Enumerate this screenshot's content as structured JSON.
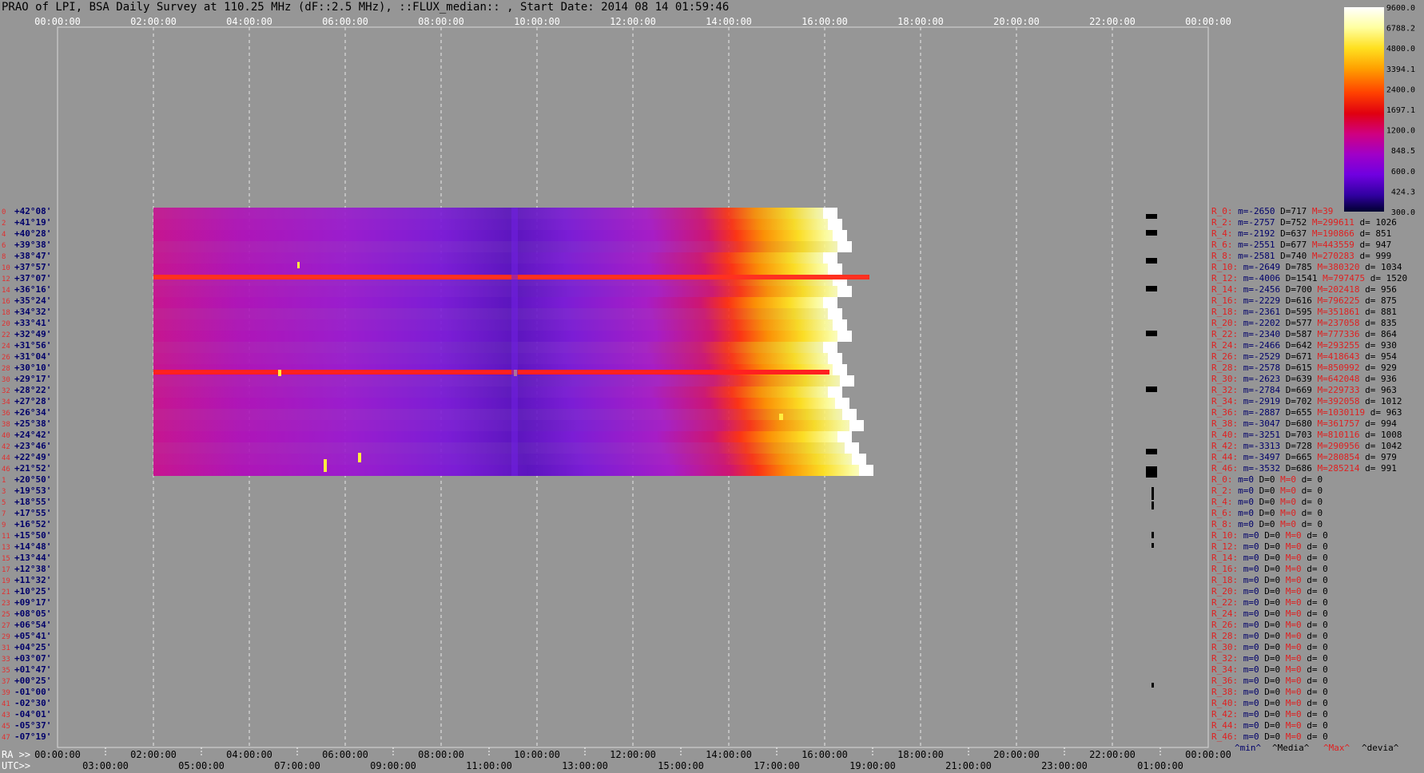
{
  "title": "PRAO of LPI, BSA Daily Survey at 110.25 MHz (dF::2.5 MHz), ::FLUX_median:: , Start Date: 2014 08 14 01:59:46",
  "colorbar": {
    "ticks": [
      "9600.0",
      "6788.2",
      "4800.0",
      "3394.1",
      "2400.0",
      "1697.1",
      "1200.0",
      "848.5",
      "600.0",
      "424.3",
      "300.0"
    ],
    "colors": [
      "#ffffff",
      "#ffffa0",
      "#ffe020",
      "#ffa000",
      "#ff4000",
      "#e00010",
      "#d00080",
      "#a000c8",
      "#7000e0",
      "#3000a0",
      "#000030"
    ]
  },
  "chart_data": {
    "type": "heatmap",
    "top_axis_ticks": [
      "00:00:00",
      "02:00:00",
      "04:00:00",
      "06:00:00",
      "08:00:00",
      "10:00:00",
      "12:00:00",
      "14:00:00",
      "16:00:00",
      "18:00:00",
      "20:00:00",
      "22:00:00",
      "00:00:00"
    ],
    "bottom_ra_label": "RA >>",
    "bottom_ra_ticks": [
      "00:00:00",
      "02:00:00",
      "04:00:00",
      "06:00:00",
      "08:00:00",
      "10:00:00",
      "12:00:00",
      "14:00:00",
      "16:00:00",
      "18:00:00",
      "20:00:00",
      "22:00:00",
      "00:00:00"
    ],
    "bottom_utc_label": "UTC>>",
    "bottom_utc_ticks": [
      "03:00:00",
      "05:00:00",
      "07:00:00",
      "09:00:00",
      "11:00:00",
      "13:00:00",
      "15:00:00",
      "17:00:00",
      "19:00:00",
      "21:00:00",
      "23:00:00",
      "01:00:00"
    ],
    "declination_labels": [
      "+42°08'",
      "+41°19'",
      "+40°28'",
      "+39°38'",
      "+38°47'",
      "+37°57'",
      "+37°07'",
      "+36°16'",
      "+35°24'",
      "+34°32'",
      "+33°41'",
      "+32°49'",
      "+31°56'",
      "+31°04'",
      "+30°10'",
      "+29°17'",
      "+28°22'",
      "+27°28'",
      "+26°34'",
      "+25°38'",
      "+24°42'",
      "+23°46'",
      "+22°49'",
      "+21°52'",
      "+20°50'",
      "+19°53'",
      "+18°55'",
      "+17°55'",
      "+16°52'",
      "+15°50'",
      "+14°48'",
      "+13°44'",
      "+12°38'",
      "+11°32'",
      "+10°25'",
      "+09°17'",
      "+08°05'",
      "+06°54'",
      "+05°41'",
      "+04°25'",
      "+03°07'",
      "+01°47'",
      "+00°25'",
      "-01°00'",
      "-02°30'",
      "-04°01'",
      "-05°37'",
      "-07°19'"
    ],
    "beam_indices": [
      "0",
      "2",
      "4",
      "6",
      "8",
      "10",
      "12",
      "14",
      "16",
      "18",
      "20",
      "22",
      "24",
      "26",
      "28",
      "30",
      "32",
      "34",
      "36",
      "38",
      "40",
      "42",
      "44",
      "46",
      "1",
      "3",
      "5",
      "7",
      "9",
      "11",
      "13",
      "15",
      "17",
      "19",
      "21",
      "23",
      "25",
      "27",
      "29",
      "31",
      "33",
      "35",
      "37",
      "39",
      "41",
      "43",
      "45",
      "47"
    ],
    "stats": [
      {
        "r": "R_0:",
        "m": "-2650",
        "D": "717",
        "M": "39",
        "d": ""
      },
      {
        "r": "R_2:",
        "m": "-2757",
        "D": "752",
        "M": "299611",
        "d": "1026"
      },
      {
        "r": "R_4:",
        "m": "-2192",
        "D": "637",
        "M": "190866",
        "d": "851"
      },
      {
        "r": "R_6:",
        "m": "-2551",
        "D": "677",
        "M": "443559",
        "d": "947"
      },
      {
        "r": "R_8:",
        "m": "-2581",
        "D": "740",
        "M": "270283",
        "d": "999"
      },
      {
        "r": "R_10:",
        "m": "-2649",
        "D": "785",
        "M": "380320",
        "d": "1034"
      },
      {
        "r": "R_12:",
        "m": "-4006",
        "D": "1541",
        "M": "797475",
        "d": "1520"
      },
      {
        "r": "R_14:",
        "m": "-2456",
        "D": "700",
        "M": "202418",
        "d": "956"
      },
      {
        "r": "R_16:",
        "m": "-2229",
        "D": "616",
        "M": "796225",
        "d": "875"
      },
      {
        "r": "R_18:",
        "m": "-2361",
        "D": "595",
        "M": "351861",
        "d": "881"
      },
      {
        "r": "R_20:",
        "m": "-2202",
        "D": "577",
        "M": "237058",
        "d": "835"
      },
      {
        "r": "R_22:",
        "m": "-2340",
        "D": "587",
        "M": "777336",
        "d": "864"
      },
      {
        "r": "R_24:",
        "m": "-2466",
        "D": "642",
        "M": "293255",
        "d": "930"
      },
      {
        "r": "R_26:",
        "m": "-2529",
        "D": "671",
        "M": "418643",
        "d": "954"
      },
      {
        "r": "R_28:",
        "m": "-2578",
        "D": "615",
        "M": "850992",
        "d": "929"
      },
      {
        "r": "R_30:",
        "m": "-2623",
        "D": "639",
        "M": "642048",
        "d": "936"
      },
      {
        "r": "R_32:",
        "m": "-2784",
        "D": "669",
        "M": "229733",
        "d": "963"
      },
      {
        "r": "R_34:",
        "m": "-2919",
        "D": "702",
        "M": "392058",
        "d": "1012"
      },
      {
        "r": "R_36:",
        "m": "-2887",
        "D": "655",
        "M": "1030119",
        "d": "963"
      },
      {
        "r": "R_38:",
        "m": "-3047",
        "D": "680",
        "M": "361757",
        "d": "994"
      },
      {
        "r": "R_40:",
        "m": "-3251",
        "D": "703",
        "M": "810116",
        "d": "1008"
      },
      {
        "r": "R_42:",
        "m": "-3313",
        "D": "728",
        "M": "290956",
        "d": "1042"
      },
      {
        "r": "R_44:",
        "m": "-3497",
        "D": "665",
        "M": "280854",
        "d": "979"
      },
      {
        "r": "R_46:",
        "m": "-3532",
        "D": "686",
        "M": "285214",
        "d": "991"
      },
      {
        "r": "R_0:",
        "m": "0",
        "D": "0",
        "M": "0",
        "d": "0"
      },
      {
        "r": "R_2:",
        "m": "0",
        "D": "0",
        "M": "0",
        "d": "0"
      },
      {
        "r": "R_4:",
        "m": "0",
        "D": "0",
        "M": "0",
        "d": "0"
      },
      {
        "r": "R_6:",
        "m": "0",
        "D": "0",
        "M": "0",
        "d": "0"
      },
      {
        "r": "R_8:",
        "m": "0",
        "D": "0",
        "M": "0",
        "d": "0"
      },
      {
        "r": "R_10:",
        "m": "0",
        "D": "0",
        "M": "0",
        "d": "0"
      },
      {
        "r": "R_12:",
        "m": "0",
        "D": "0",
        "M": "0",
        "d": "0"
      },
      {
        "r": "R_14:",
        "m": "0",
        "D": "0",
        "M": "0",
        "d": "0"
      },
      {
        "r": "R_16:",
        "m": "0",
        "D": "0",
        "M": "0",
        "d": "0"
      },
      {
        "r": "R_18:",
        "m": "0",
        "D": "0",
        "M": "0",
        "d": "0"
      },
      {
        "r": "R_20:",
        "m": "0",
        "D": "0",
        "M": "0",
        "d": "0"
      },
      {
        "r": "R_22:",
        "m": "0",
        "D": "0",
        "M": "0",
        "d": "0"
      },
      {
        "r": "R_24:",
        "m": "0",
        "D": "0",
        "M": "0",
        "d": "0"
      },
      {
        "r": "R_26:",
        "m": "0",
        "D": "0",
        "M": "0",
        "d": "0"
      },
      {
        "r": "R_28:",
        "m": "0",
        "D": "0",
        "M": "0",
        "d": "0"
      },
      {
        "r": "R_30:",
        "m": "0",
        "D": "0",
        "M": "0",
        "d": "0"
      },
      {
        "r": "R_32:",
        "m": "0",
        "D": "0",
        "M": "0",
        "d": "0"
      },
      {
        "r": "R_34:",
        "m": "0",
        "D": "0",
        "M": "0",
        "d": "0"
      },
      {
        "r": "R_36:",
        "m": "0",
        "D": "0",
        "M": "0",
        "d": "0"
      },
      {
        "r": "R_38:",
        "m": "0",
        "D": "0",
        "M": "0",
        "d": "0"
      },
      {
        "r": "R_40:",
        "m": "0",
        "D": "0",
        "M": "0",
        "d": "0"
      },
      {
        "r": "R_42:",
        "m": "0",
        "D": "0",
        "M": "0",
        "d": "0"
      },
      {
        "r": "R_44:",
        "m": "0",
        "D": "0",
        "M": "0",
        "d": "0"
      },
      {
        "r": "R_46:",
        "m": "0",
        "D": "0",
        "M": "0",
        "d": "0"
      }
    ],
    "legend": {
      "min": "^min^",
      "median": "^Media^",
      "max": "^Max^",
      "deviation": "^devia^"
    }
  }
}
